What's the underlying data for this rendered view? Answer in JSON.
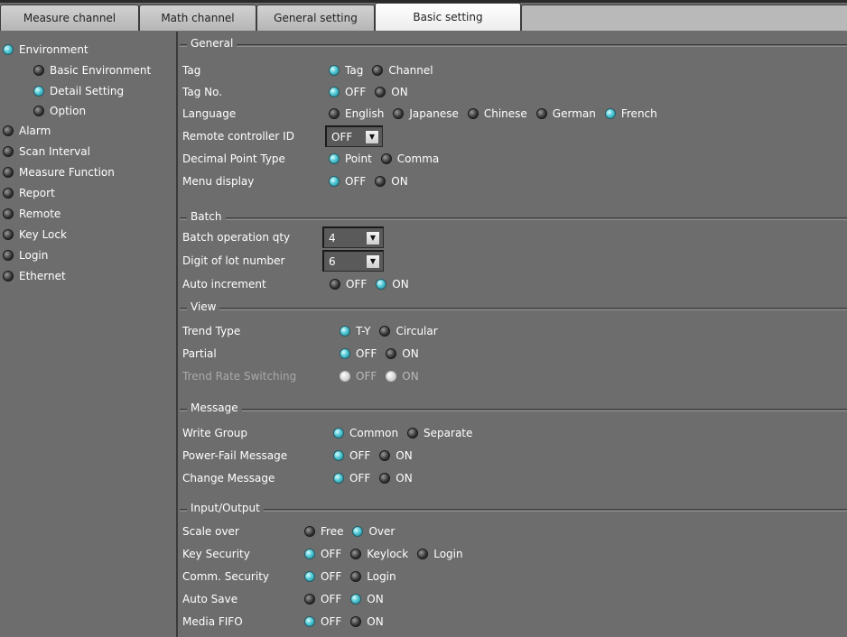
{
  "tabs": [
    {
      "label": "Measure channel"
    },
    {
      "label": "Math channel"
    },
    {
      "label": "General setting"
    },
    {
      "label": "Basic setting"
    }
  ],
  "sidebar": {
    "items": [
      {
        "label": "Environment",
        "selected": true
      },
      {
        "label": "Basic Environment",
        "selected": false
      },
      {
        "label": "Detail Setting",
        "selected": true
      },
      {
        "label": "Option",
        "selected": false
      },
      {
        "label": "Alarm",
        "selected": false
      },
      {
        "label": "Scan Interval",
        "selected": false
      },
      {
        "label": "Measure Function",
        "selected": false
      },
      {
        "label": "Report",
        "selected": false
      },
      {
        "label": "Remote",
        "selected": false
      },
      {
        "label": "Key Lock",
        "selected": false
      },
      {
        "label": "Login",
        "selected": false
      },
      {
        "label": "Ethernet",
        "selected": false
      }
    ]
  },
  "sections": {
    "general": {
      "title": "General",
      "tag": {
        "label": "Tag",
        "options": [
          "Tag",
          "Channel"
        ],
        "selected": "Tag"
      },
      "tag_no": {
        "label": "Tag No.",
        "options": [
          "OFF",
          "ON"
        ],
        "selected": "OFF"
      },
      "language": {
        "label": "Language",
        "options": [
          "English",
          "Japanese",
          "Chinese",
          "German",
          "French"
        ],
        "selected": "French"
      },
      "remote_id": {
        "label": "Remote controller ID",
        "value": "OFF"
      },
      "decimal": {
        "label": "Decimal Point Type",
        "options": [
          "Point",
          "Comma"
        ],
        "selected": "Point"
      },
      "menu_display": {
        "label": "Menu display",
        "options": [
          "OFF",
          "ON"
        ],
        "selected": "OFF"
      }
    },
    "batch": {
      "title": "Batch",
      "qty": {
        "label": "Batch operation qty",
        "value": "4"
      },
      "lot_digits": {
        "label": "Digit of lot number",
        "value": "6"
      },
      "auto_increment": {
        "label": "Auto increment",
        "options": [
          "OFF",
          "ON"
        ],
        "selected": "ON"
      }
    },
    "view": {
      "title": "View",
      "trend_type": {
        "label": "Trend Type",
        "options": [
          "T-Y",
          "Circular"
        ],
        "selected": "T-Y"
      },
      "partial": {
        "label": "Partial",
        "options": [
          "OFF",
          "ON"
        ],
        "selected": "OFF"
      },
      "trend_rate": {
        "label": "Trend Rate Switching",
        "options": [
          "OFF",
          "ON"
        ],
        "disabled": true
      }
    },
    "message": {
      "title": "Message",
      "write_group": {
        "label": "Write Group",
        "options": [
          "Common",
          "Separate"
        ],
        "selected": "Common"
      },
      "power_fail": {
        "label": "Power-Fail Message",
        "options": [
          "OFF",
          "ON"
        ],
        "selected": "OFF"
      },
      "change_msg": {
        "label": "Change Message",
        "options": [
          "OFF",
          "ON"
        ],
        "selected": "OFF"
      }
    },
    "io": {
      "title": "Input/Output",
      "scale_over": {
        "label": "Scale over",
        "options": [
          "Free",
          "Over"
        ],
        "selected": "Over"
      },
      "key_security": {
        "label": "Key Security",
        "options": [
          "OFF",
          "Keylock",
          "Login"
        ],
        "selected": "OFF"
      },
      "comm_security": {
        "label": "Comm. Security",
        "options": [
          "OFF",
          "Login"
        ],
        "selected": "OFF"
      },
      "auto_save": {
        "label": "Auto Save",
        "options": [
          "OFF",
          "ON"
        ],
        "selected": "ON"
      },
      "media_fifo": {
        "label": "Media FIFO",
        "options": [
          "OFF",
          "ON"
        ],
        "selected": "OFF"
      }
    }
  },
  "colors": {
    "background": "#6d6d6d",
    "radio_selected": "#4fc6d4",
    "radio_unselected": "#3a3a3a",
    "tab_active": "#ffffff",
    "tab_inactive": "#c4c4c4"
  }
}
